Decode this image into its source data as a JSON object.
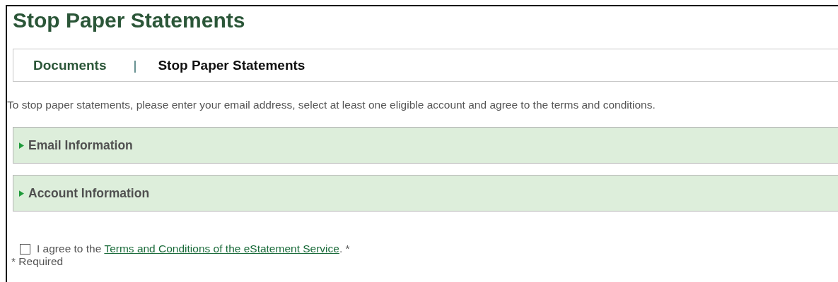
{
  "title": "Stop Paper Statements",
  "breadcrumb": [
    {
      "label": "Documents",
      "selected": false
    },
    {
      "label": "Stop Paper Statements",
      "selected": true
    }
  ],
  "breadcrumb_separator": "|",
  "intro": "To stop paper statements, please enter your email address, select at least one eligible account and agree to the terms and conditions.",
  "sections": [
    {
      "label": "Email Information",
      "expanded": false
    },
    {
      "label": "Account Information",
      "expanded": false
    }
  ],
  "agreement": {
    "checked": false,
    "text_before": "I agree to the",
    "link": "Terms and Conditions of the eStatement Service",
    "text_after": ". *"
  },
  "required_note": "* Required"
}
